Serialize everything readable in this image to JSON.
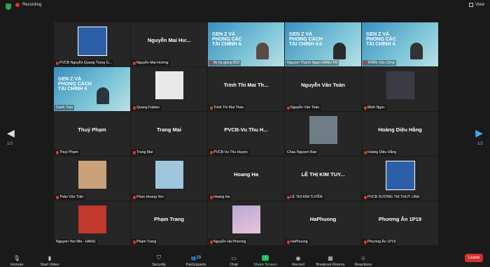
{
  "topbar": {
    "recording": "Recording",
    "view": "View"
  },
  "pager": {
    "left": "1/2",
    "right": "1/2"
  },
  "tiles": [
    {
      "title": "",
      "label": "PVCB Nguyễn Quang Trung G..."
    },
    {
      "title": "Nguyễn Mai Hư...",
      "label": "Nguyễn Mai Hương"
    },
    {
      "title": "",
      "label": "thị hà giang BÙI",
      "slide": "GEN Z VÀ PHONG CÁC TÀI CHÍNH 4."
    },
    {
      "title": "",
      "label": "Nguyen Thanh Ngan HANU FR",
      "slide": "GEN Z VÀ PHONG CÁCH TÀI CHÍNH 4.0"
    },
    {
      "title": "",
      "label": "TRẦN Văn Công",
      "slide": "GEN Z VÀ PHONG CÁC TÀI CHÍNH 4."
    },
    {
      "title": "",
      "label": "Danh Tran",
      "slide": "GEN Z VÀ PHONG CÁCH TÀI CHÍNH 4"
    },
    {
      "title": "",
      "label": "Quang Fabien"
    },
    {
      "title": "Trinh Thi Mai Th...",
      "label": "Trinh Thi Mai Thao"
    },
    {
      "title": "Nguyễn Văn Toàn",
      "label": "Nguyễn Văn Toàn"
    },
    {
      "title": "",
      "label": "Minh Ngọc"
    },
    {
      "title": "Thuý Phạm",
      "label": "Thuý Phạm"
    },
    {
      "title": "Trang Mai",
      "label": "Trang Mai"
    },
    {
      "title": "PVCB-Vu Thu H...",
      "label": "PVCB-Vu Thu Huyen"
    },
    {
      "title": "",
      "label": "Chau Nguyen Bao"
    },
    {
      "title": "Hoàng Diệu Hằng",
      "label": "Hoàng Diệu Hằng"
    },
    {
      "title": "",
      "label": "Thảo Vân Trần"
    },
    {
      "title": "",
      "label": "Phan Hoang Yen"
    },
    {
      "title": "Hoang Ha",
      "label": "Hoang Ha"
    },
    {
      "title": "LÊ THỊ KIM TUY...",
      "label": "LÊ THỊ KIM TUYỀN"
    },
    {
      "title": "",
      "label": "PVCB DƯƠNG THỊ THUỲ LINH"
    },
    {
      "title": "",
      "label": "Nguyen Yen Nhi - HANU"
    },
    {
      "title": "Phạm Trang",
      "label": "Phạm Trang"
    },
    {
      "title": "",
      "label": "Nguyễn Hà Phương"
    },
    {
      "title": "HaPhuong",
      "label": "HaPhuong"
    },
    {
      "title": "Phương Ân 1P19",
      "label": "Phương Ân 1P19"
    }
  ],
  "toolbar": {
    "unmute": "Unmute",
    "video": "Start Video",
    "security": "Security",
    "participants": "Participants",
    "participants_count": "29",
    "chat": "Chat",
    "share": "Share Screen",
    "record": "Record",
    "breakout": "Breakout Rooms",
    "reactions": "Reactions",
    "leave": "Leave"
  },
  "colors": {
    "active_border": "#9ccc65",
    "leave": "#d32f2f",
    "share": "#23c25a",
    "mic_muted": "#e0342d"
  }
}
